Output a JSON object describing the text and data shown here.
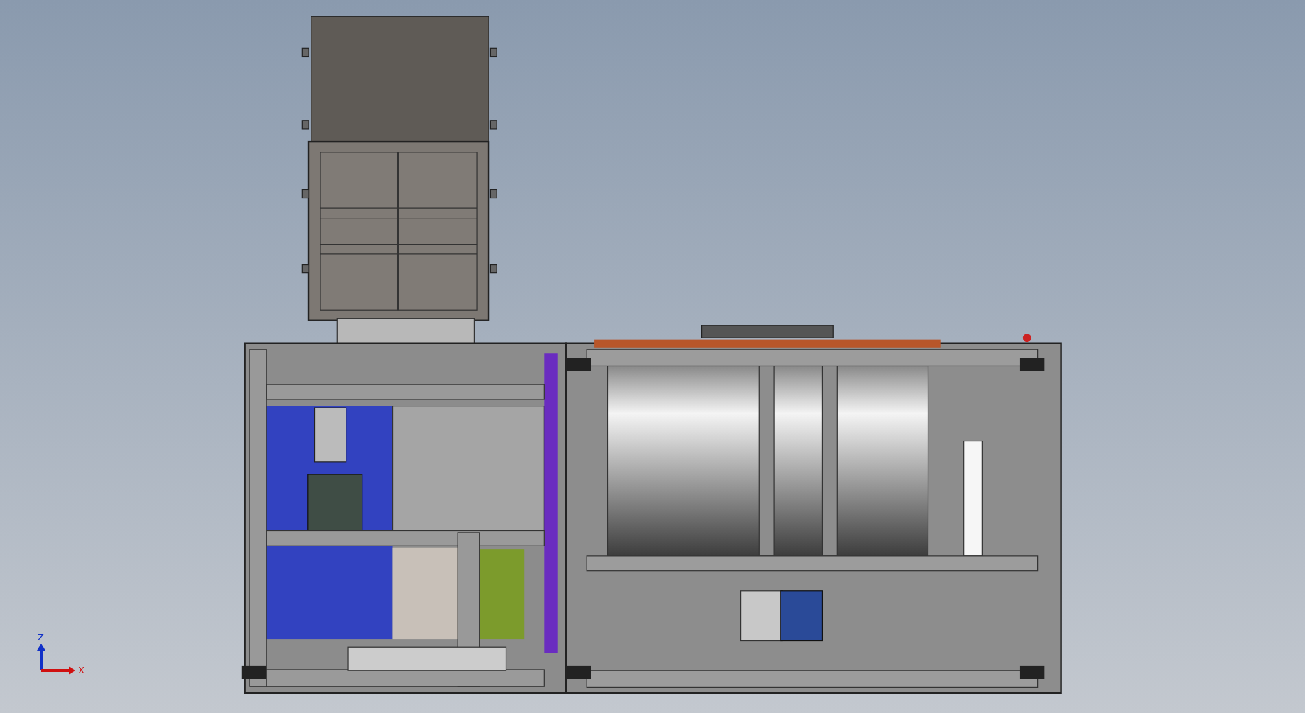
{
  "viewport": {
    "triad": {
      "axes": [
        {
          "kind": "z",
          "label": "Z"
        },
        {
          "kind": "x",
          "label": "X"
        }
      ]
    }
  }
}
